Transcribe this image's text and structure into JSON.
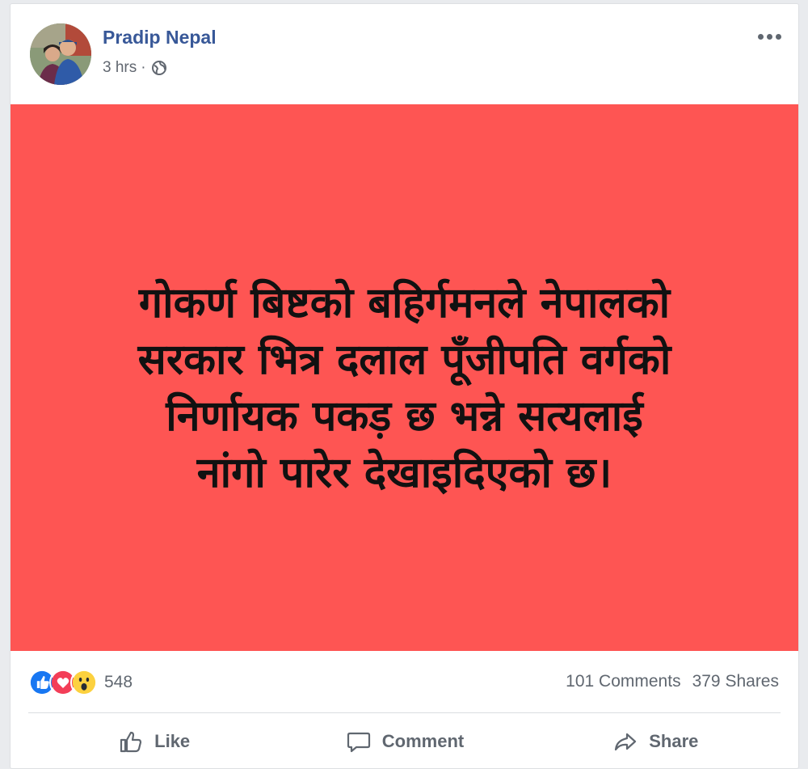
{
  "post": {
    "author": "Pradip Nepal",
    "time": "3 hrs",
    "separator": "·",
    "privacy_icon": "globe-icon",
    "image_bg_color": "#fe5553",
    "text_lines": [
      "गोकर्ण बिष्टको बहिर्गमनले नेपालको",
      "सरकार भित्र दलाल पूँजीपति वर्गको",
      "निर्णायक पकड़ छ भन्ने सत्यलाई",
      "नांगो पारेर देखाइदिएको छ।"
    ]
  },
  "stats": {
    "reaction_icons": [
      "like-reaction-icon",
      "love-reaction-icon",
      "wow-reaction-icon"
    ],
    "reaction_count": "548",
    "comments": "101 Comments",
    "shares": "379 Shares"
  },
  "actions": {
    "like": "Like",
    "comment": "Comment",
    "share": "Share"
  },
  "colors": {
    "author_link": "#385898",
    "like_blue": "#1877f2",
    "love_red": "#f33e58"
  }
}
